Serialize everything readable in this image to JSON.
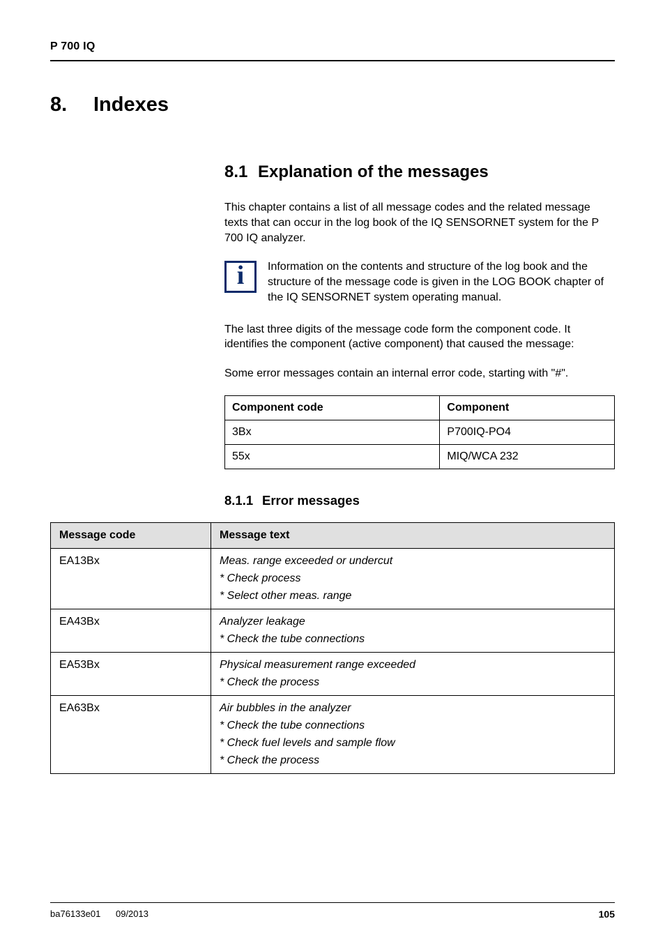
{
  "header": {
    "running": "P 700 IQ"
  },
  "chapter": {
    "number": "8.",
    "title": "Indexes"
  },
  "section": {
    "number": "8.1",
    "title": "Explanation of the messages"
  },
  "paras": {
    "intro_a": "This chapter contains a list of all message codes and the related message texts that can occur in the log book of the IQ S",
    "intro_b": "ENSOR",
    "intro_c": "N",
    "intro_d": "ET",
    "intro_e": " system for the P 700 IQ analyzer.",
    "note_a": "Information on the contents and structure of the log book and the structure of the message code is given in the L",
    "note_b": "OG BOOK",
    "note_c": " chapter of the IQ S",
    "note_d": "ENSOR",
    "note_e": "N",
    "note_f": "ET",
    "note_g": " system operating manual.",
    "p2": "The last three digits of the message code form the component code. It identifies the component (active component) that caused the message:",
    "p3": "Some error messages contain an internal error code, starting with \"#\"."
  },
  "component_table": {
    "headers": [
      "Component code",
      "Component"
    ],
    "rows": [
      [
        "3Bx",
        "P700IQ-PO4"
      ],
      [
        "55x",
        "MIQ/WCA 232"
      ]
    ]
  },
  "subsubsection": {
    "number": "8.1.1",
    "title": "Error messages"
  },
  "messages_table": {
    "headers": [
      "Message code",
      "Message text"
    ],
    "rows": [
      {
        "code": "EA13Bx",
        "lines": [
          "Meas. range exceeded or undercut",
          "* Check process",
          "* Select other meas. range"
        ]
      },
      {
        "code": "EA43Bx",
        "lines": [
          "Analyzer leakage",
          "* Check the tube connections"
        ]
      },
      {
        "code": "EA53Bx",
        "lines": [
          "Physical measurement range exceeded",
          "* Check the process"
        ]
      },
      {
        "code": "EA63Bx",
        "lines": [
          "Air bubbles in the analyzer",
          "* Check the tube connections",
          "* Check fuel levels and sample flow",
          "* Check the process"
        ]
      }
    ]
  },
  "footer": {
    "left_a": "ba76133e01",
    "left_b": "09/2013",
    "right": "105"
  },
  "icons": {
    "info": "i"
  }
}
